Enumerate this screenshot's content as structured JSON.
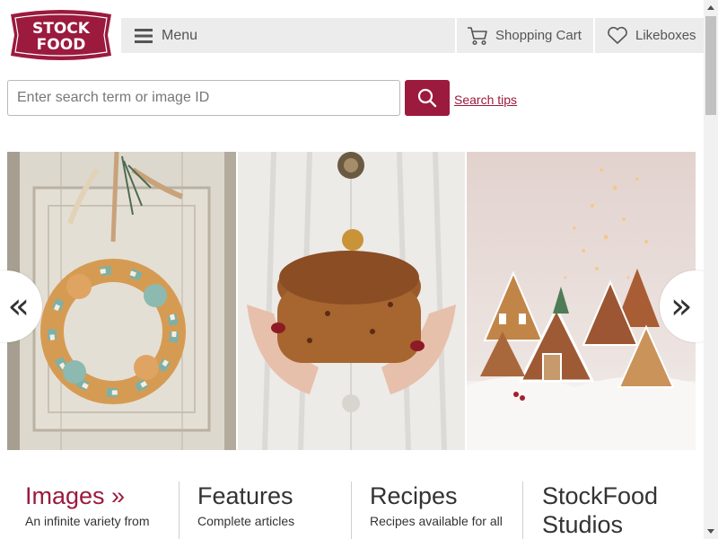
{
  "brand": {
    "logo_line1": "STOCK",
    "logo_line2": "FOOD",
    "color": "#9b1a3e"
  },
  "header": {
    "menu_label": "Menu",
    "menu_icon": "hamburger-icon",
    "cart_label": "Shopping Cart",
    "cart_icon": "cart-icon",
    "likeboxes_label": "Likeboxes",
    "likeboxes_icon": "heart-icon"
  },
  "search": {
    "placeholder": "Enter search term or image ID",
    "value": "",
    "button_icon": "search-icon",
    "tips_label": "Search tips"
  },
  "carousel": {
    "prev_label": "«",
    "next_label": "»",
    "slides": [
      {
        "subject": "gingerbread cookie wreath on rustic white door"
      },
      {
        "subject": "hands holding a round panettone loaf"
      },
      {
        "subject": "gingerbread houses in snow with fairy lights"
      }
    ]
  },
  "columns": [
    {
      "title": "Images »",
      "desc": "An infinite variety from"
    },
    {
      "title": "Features",
      "desc": "Complete articles"
    },
    {
      "title": "Recipes",
      "desc": "Recipes available for all"
    },
    {
      "title": "StockFood Studios",
      "desc": ""
    }
  ]
}
